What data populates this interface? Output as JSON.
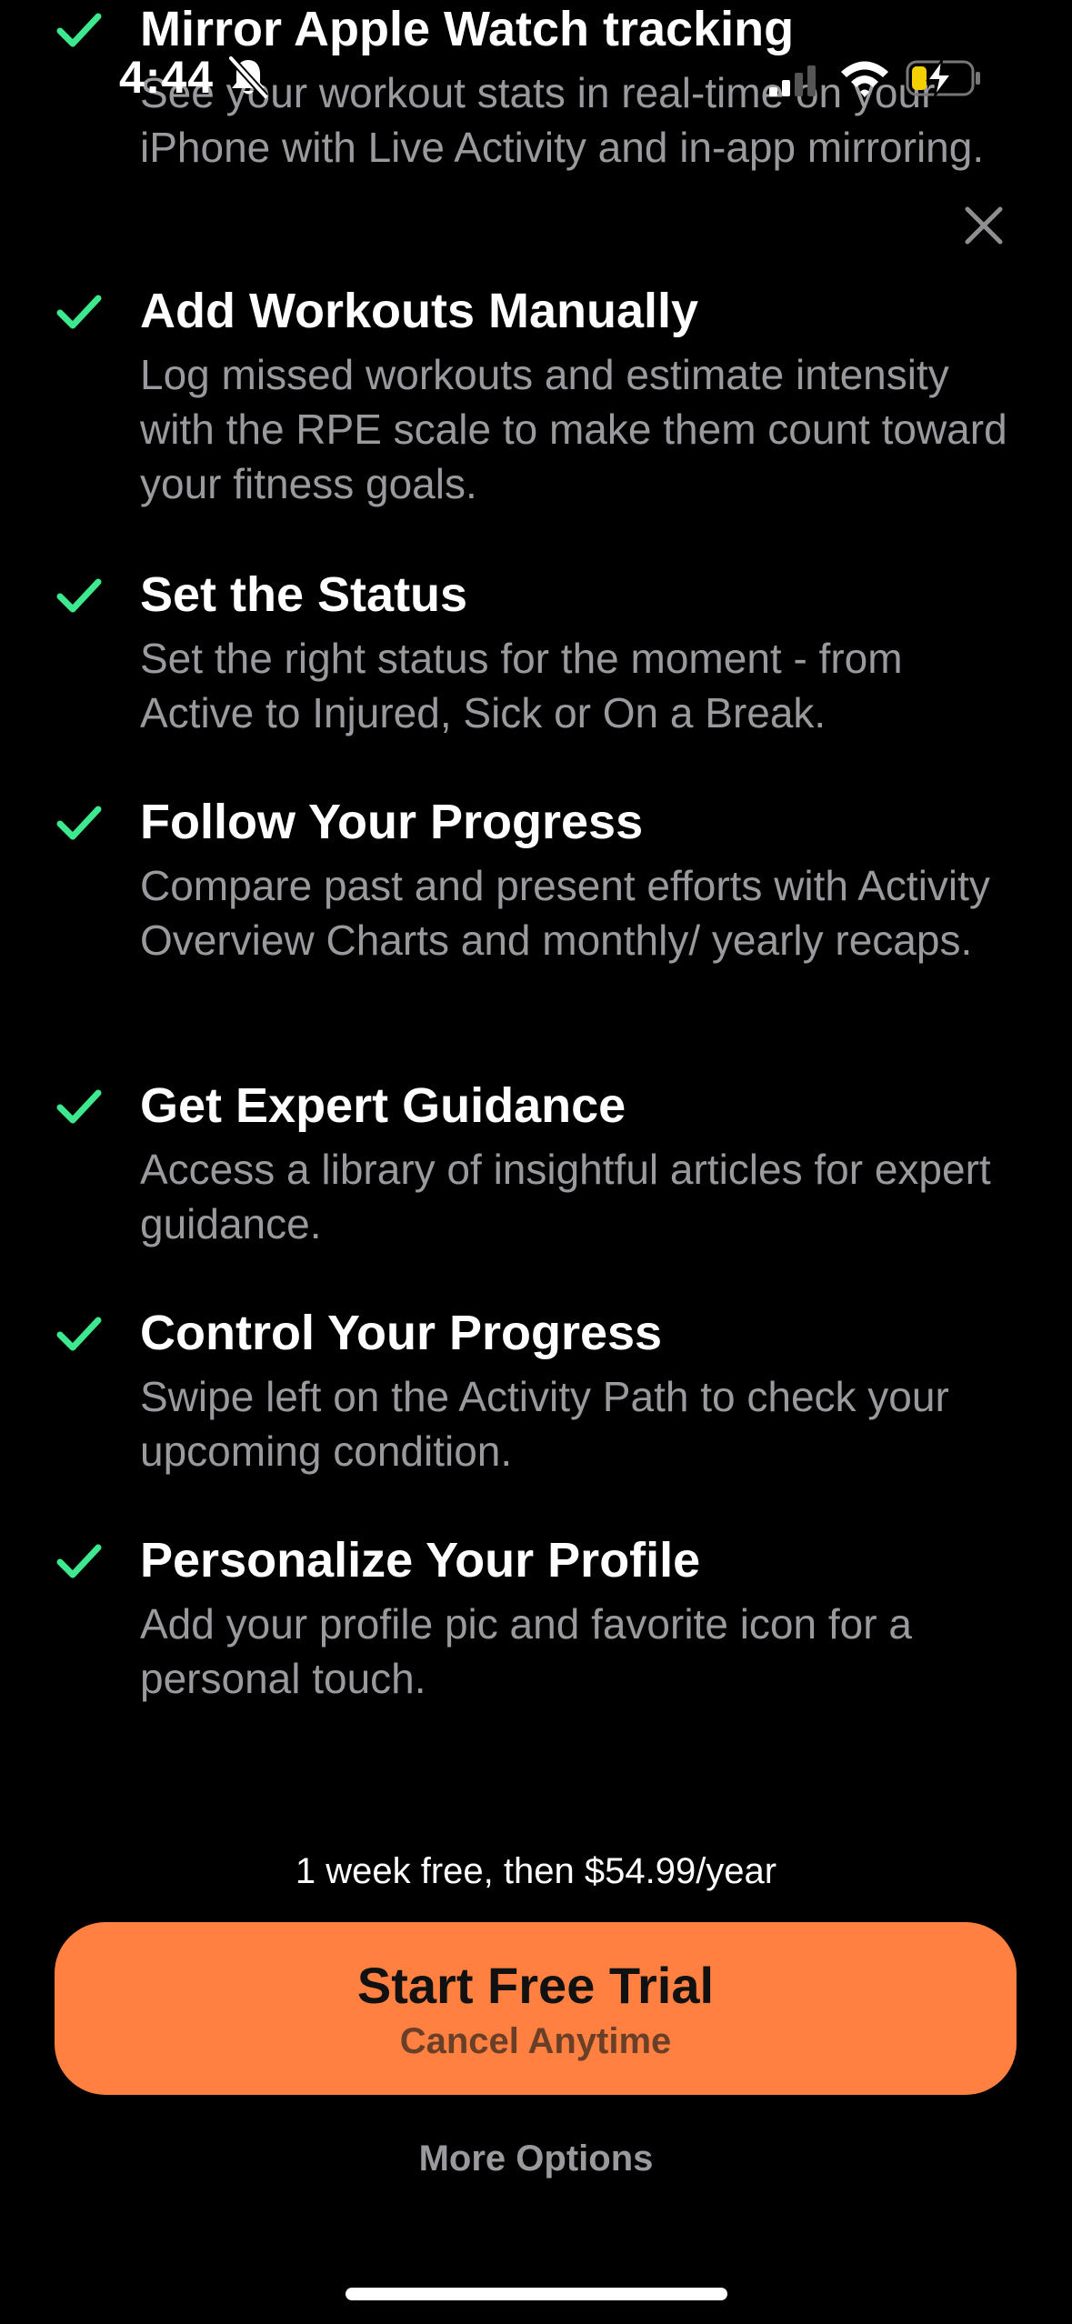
{
  "status_bar": {
    "time": "4:44",
    "icons": [
      "bell-slash-icon",
      "cellular-signal-icon",
      "wifi-icon",
      "battery-charging-icon"
    ]
  },
  "close": {
    "icon": "close-icon"
  },
  "features": [
    {
      "title": "Mirror Apple Watch tracking",
      "description": "See your workout stats in real-time on your iPhone with Live Activity and in-app mirroring."
    },
    {
      "title": "Add Workouts Manually",
      "description": "Log missed workouts and estimate intensity with the RPE scale to make them count toward your fitness goals."
    },
    {
      "title": "Set the Status",
      "description": "Set the right status for the moment - from Active to Injured, Sick or On a Break."
    },
    {
      "title": "Follow Your Progress",
      "description": "Compare past and present efforts with Activity Overview Charts and monthly/ yearly recaps."
    },
    {
      "title": "Get Expert Guidance",
      "description": "Access a library of insightful articles for expert guidance."
    },
    {
      "title": "Control Your Progress",
      "description": "Swipe left on the Activity Path to check your upcoming condition."
    },
    {
      "title": "Personalize Your Profile",
      "description": "Add your profile pic and favorite icon for a personal touch."
    }
  ],
  "pricing": {
    "text": "1 week free, then $54.99/year"
  },
  "cta": {
    "title": "Start Free Trial",
    "subtitle": "Cancel Anytime"
  },
  "more_options": {
    "label": "More Options"
  },
  "colors": {
    "accent": "#ff8040",
    "check": "#3ee88f",
    "secondary_text": "#9a9a9e",
    "background": "#000000"
  }
}
